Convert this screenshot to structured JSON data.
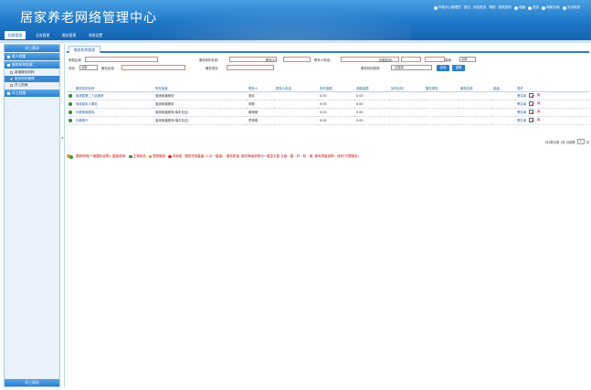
{
  "app": {
    "title": "居家养老网络管理中心"
  },
  "topbar": {
    "items": [
      {
        "label": "华顺中心管理员",
        "icon": "user-icon"
      },
      {
        "label": "退出",
        "icon": "logout-icon"
      },
      {
        "label": "系统首页",
        "icon": "home-icon"
      },
      {
        "label": "帮助",
        "icon": "help-icon"
      },
      {
        "label": "修改密码",
        "icon": "key-icon"
      },
      {
        "label": "收藏",
        "icon": "star-icon"
      },
      {
        "label": "首页",
        "icon": "home2-icon"
      },
      {
        "label": "刷新页面",
        "icon": "refresh-icon"
      },
      {
        "label": "关闭系统",
        "icon": "power-icon"
      }
    ]
  },
  "nav": {
    "tabs": [
      "档案管理",
      "业务管理",
      "服务管理",
      "系统设置"
    ],
    "active": 0
  },
  "sidebar": {
    "scroll_up": "向上滚动",
    "scroll_down": "向上滚动",
    "groups": [
      {
        "label": "老人档案",
        "items": []
      },
      {
        "label": "服务机构档案",
        "items": [
          {
            "label": "新增服务机构",
            "selected": false
          },
          {
            "label": "服务机构管理",
            "selected": true
          },
          {
            "label": "员工档案",
            "selected": false
          }
        ]
      },
      {
        "label": "义工档案",
        "items": []
      }
    ]
  },
  "panel": {
    "tab": "服务机构管理"
  },
  "filters": {
    "owner_label": "所属区域:",
    "org_name_label": "服务机构名称:",
    "contact_label": "联系人:",
    "contact_phone_label": "联系人电话:",
    "score_label": "定额区间:",
    "level_label": "星级:",
    "level_value": "全部",
    "status_label": "状态:",
    "status_value": "全部",
    "service_label": "服务区域:",
    "service_item_label": "服务项目:",
    "org_type_label": "服务机构类型:",
    "org_type_value": "--请选择--",
    "search_btn": "查询",
    "reset_btn": "重置"
  },
  "table": {
    "headers": [
      "服务机构名称",
      "所在街道",
      "联系人",
      "联系人电话",
      "协作金额",
      "调度金额",
      "协作比例",
      "服务类型",
      "服务名称",
      "星级",
      "操作"
    ],
    "rows": [
      {
        "name": "宝润居第二人民医院",
        "street": "宝润街道服务",
        "contact": "张珍",
        "phone": "",
        "a": "0.00",
        "b": "0.00",
        "op": "黑名单"
      },
      {
        "name": "宝润英民人服务",
        "street": "宝润街道服务",
        "contact": "张柳",
        "phone": "",
        "a": "0.00",
        "b": "0.00",
        "op": "黑名单"
      },
      {
        "name": "华都家政服务",
        "street": "宝润街道服务(瑞丰社区)",
        "contact": "黄海德",
        "phone": "",
        "a": "0.00",
        "b": "0.00",
        "op": "黑名单"
      },
      {
        "name": "华都餐厅",
        "street": "宝润街道服务(瑞丰社区)",
        "contact": "贾杨德",
        "phone": "",
        "a": "0.00",
        "b": "0.00",
        "op": "黑名单"
      }
    ]
  },
  "pager": {
    "summary": "共4条记录 1页 当前第",
    "page": "1",
    "suffix": "页"
  },
  "legend": {
    "prefix": "图例说明(个案图标说明): 星级说明:",
    "items": [
      {
        "label": "正常状态",
        "color": "#2e8b2e"
      },
      {
        "label": "暂停服务",
        "color": "#e08a00"
      },
      {
        "label": "未验收",
        "color": "#d22"
      }
    ],
    "suffix": "服务完成星级: 1-3(一星级) - 服务质量, 服务等级说明为一星至五星 五级 - 星 - 好 - 较 - 差; 服务质量说明 - 良好(可提服务)"
  }
}
